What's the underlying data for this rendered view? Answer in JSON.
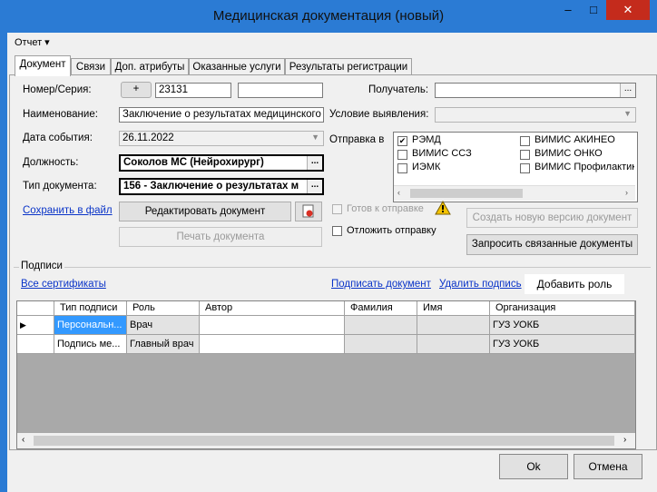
{
  "window": {
    "title": "Медицинская документация (новый)",
    "minimize": "‒",
    "maximize": "□",
    "close": "✕"
  },
  "menu": {
    "report": "Отчет ▾"
  },
  "tabs": [
    "Документ",
    "Связи",
    "Доп. атрибуты",
    "Оказанные услуги",
    "Результаты регистрации"
  ],
  "form": {
    "number_label": "Номер/Серия:",
    "plus_button": "+",
    "number_value": "23131",
    "series_value": "",
    "name_label": "Наименование:",
    "name_value": "Заключение о результатах медицинского о",
    "event_date_label": "Дата события:",
    "event_date_value": "26.11.2022",
    "position_label": "Должность:",
    "position_value": "Соколов МС (Нейрохирург)",
    "doc_type_label": "Тип документа:",
    "doc_type_value": "156 - Заключение о результатах м",
    "recipient_label": "Получатель:",
    "recipient_value": "",
    "detection_label": "Условие выявления:",
    "detection_value": "",
    "send_to_label": "Отправка в",
    "send_targets": [
      {
        "label": "РЭМД",
        "checked": true
      },
      {
        "label": "ВИМИС АКИНЕО",
        "checked": false
      },
      {
        "label": "ВИМИС ССЗ",
        "checked": false
      },
      {
        "label": "ВИМИС ОНКО",
        "checked": false
      },
      {
        "label": "ИЭМК",
        "checked": false
      },
      {
        "label": "ВИМИС Профилактика",
        "checked": false
      }
    ],
    "save_to_file": "Сохранить в файл",
    "edit_document": "Редактировать документ",
    "print_document": "Печать документа",
    "ready_to_send": "Готов к отправке",
    "postpone_send": "Отложить отправку",
    "create_new_version": "Создать новую версию документ",
    "request_related": "Запросить связанные документы"
  },
  "signatures": {
    "group_label": "Подписи",
    "all_certificates": "Все сертификаты",
    "sign_document": "Подписать документ",
    "delete_signature": "Удалить подпись",
    "add_role": "Добавить роль",
    "columns": [
      "Тип подписи",
      "Роль",
      "Автор",
      "Фамилия",
      "Имя",
      "Организация"
    ],
    "rows": [
      {
        "type": "Персональн...",
        "role": "Врач",
        "author": "",
        "surname": "",
        "name": "",
        "org": "ГУЗ УОКБ"
      },
      {
        "type": "Подпись ме...",
        "role": "Главный врач",
        "author": "",
        "surname": "",
        "name": "",
        "org": "ГУЗ УОКБ"
      }
    ]
  },
  "footer": {
    "ok": "Ok",
    "cancel": "Отмена"
  },
  "colors": {
    "title_bar": "#2b7bd4",
    "close_button": "#c42b1c",
    "selected_cell": "#3399ff"
  }
}
